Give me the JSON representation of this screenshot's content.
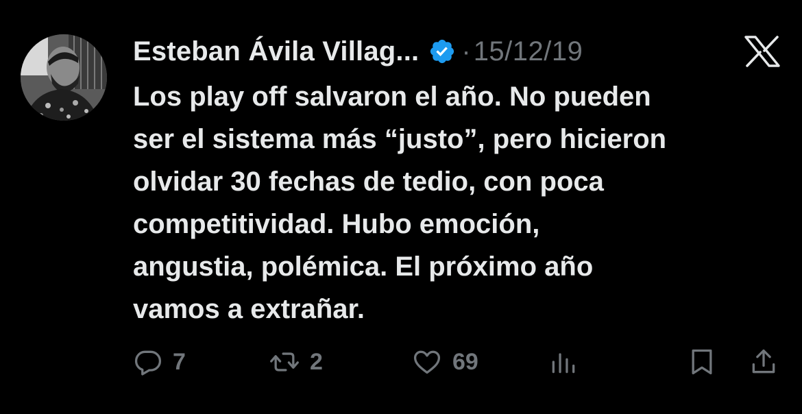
{
  "tweet": {
    "author_name": "Esteban Ávila Villag...",
    "separator": "·",
    "date": "15/12/19",
    "text_lines": [
      "Los play off salvaron el año. No pueden",
      "ser el sistema más “justo”, pero hicieron",
      "olvidar 30 fechas de tedio, con poca",
      "competitividad. Hubo emoción,",
      "angustia, polémica. El próximo año",
      "vamos a extrañar."
    ],
    "verified": true,
    "platform_icon": "x-logo-icon"
  },
  "actions": {
    "replies": "7",
    "reposts": "2",
    "likes": "69",
    "reply_icon": "reply-icon",
    "repost_icon": "repost-icon",
    "like_icon": "heart-icon",
    "views_icon": "views-icon",
    "bookmark_icon": "bookmark-icon",
    "share_icon": "share-icon"
  },
  "colors": {
    "background": "#000000",
    "text": "#e7e9ea",
    "muted": "#71767b",
    "verified_badge": "#1d9bf0"
  }
}
